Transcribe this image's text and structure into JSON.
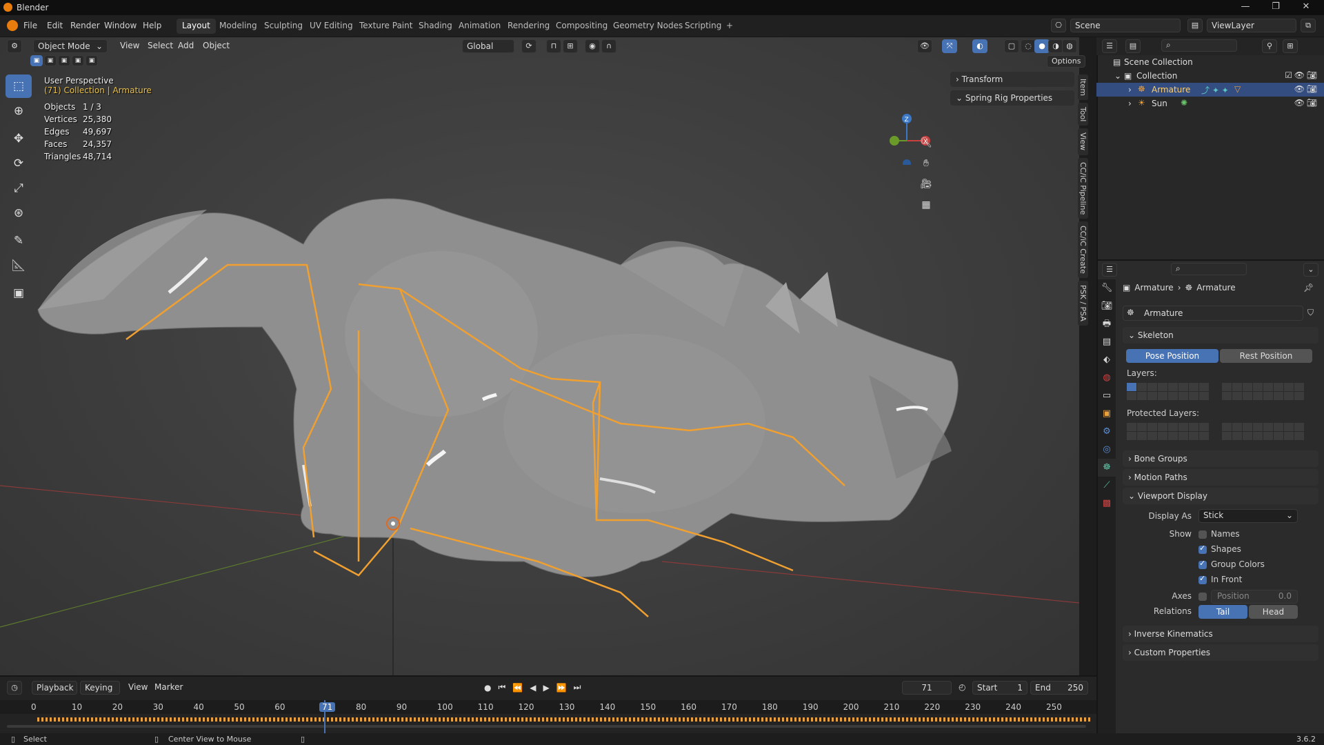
{
  "window": {
    "title": "Blender",
    "buttons": [
      "—",
      "❐",
      "✕"
    ]
  },
  "menu": [
    "File",
    "Edit",
    "Render",
    "Window",
    "Help"
  ],
  "workspaces": [
    "Layout",
    "Modeling",
    "Sculpting",
    "UV Editing",
    "Texture Paint",
    "Shading",
    "Animation",
    "Rendering",
    "Compositing",
    "Geometry Nodes",
    "Scripting",
    "+"
  ],
  "active_workspace": "Layout",
  "scene": {
    "scene_name": "Scene",
    "view_layer": "ViewLayer"
  },
  "viewport_header": {
    "mode": "Object Mode",
    "menus": [
      "View",
      "Select",
      "Add",
      "Object"
    ],
    "orientation": "Global",
    "options": "Options"
  },
  "overlay": {
    "perspective": "User Perspective",
    "collection": "(71) Collection | Armature",
    "stats": [
      {
        "k": "Objects",
        "v": "1 / 3"
      },
      {
        "k": "Vertices",
        "v": "25,380"
      },
      {
        "k": "Edges",
        "v": "49,697"
      },
      {
        "k": "Faces",
        "v": "24,357"
      },
      {
        "k": "Triangles",
        "v": "48,714"
      }
    ]
  },
  "n_panel": {
    "tabs": [
      "Item",
      "Tool",
      "View",
      "CC/iC Pipeline",
      "CC/iC Create",
      "PSK / PSA"
    ],
    "sections": [
      "Transform",
      "Spring Rig Properties"
    ]
  },
  "outliner": {
    "root": "Scene Collection",
    "collection": "Collection",
    "items": [
      "Armature",
      "Sun"
    ]
  },
  "properties": {
    "breadcrumb": [
      "Armature",
      "Armature"
    ],
    "datablock": "Armature",
    "skeleton": "Skeleton",
    "pose_position": "Pose Position",
    "rest_position": "Rest Position",
    "layers_label": "Layers:",
    "protected_label": "Protected Layers:",
    "bone_groups": "Bone Groups",
    "motion_paths": "Motion Paths",
    "viewport_display": "Viewport Display",
    "display_as_label": "Display As",
    "display_as": "Stick",
    "show_label": "Show",
    "names": "Names",
    "shapes": "Shapes",
    "group_colors": "Group Colors",
    "in_front": "In Front",
    "axes_label": "Axes",
    "position_label": "Position",
    "position_value": "0.0",
    "relations_label": "Relations",
    "tail": "Tail",
    "head": "Head",
    "inverse_kinematics": "Inverse Kinematics",
    "custom_properties": "Custom Properties"
  },
  "timeline": {
    "menus": [
      "Playback",
      "Keying",
      "View",
      "Marker"
    ],
    "current_frame": "71",
    "start_label": "Start",
    "start": "1",
    "end_label": "End",
    "end": "250",
    "ticks": [
      "0",
      "10",
      "20",
      "30",
      "40",
      "50",
      "60",
      "71",
      "80",
      "90",
      "100",
      "110",
      "120",
      "130",
      "140",
      "150",
      "160",
      "170",
      "180",
      "190",
      "200",
      "210",
      "220",
      "230",
      "240",
      "250"
    ]
  },
  "status": {
    "left": "Select",
    "middle": "Center View to Mouse",
    "version": "3.6.2"
  },
  "colors": {
    "accent": "#4772b3",
    "selected_row": "#334d80",
    "bone": "#f0a030",
    "overlay_yellow": "#e8c04a"
  }
}
